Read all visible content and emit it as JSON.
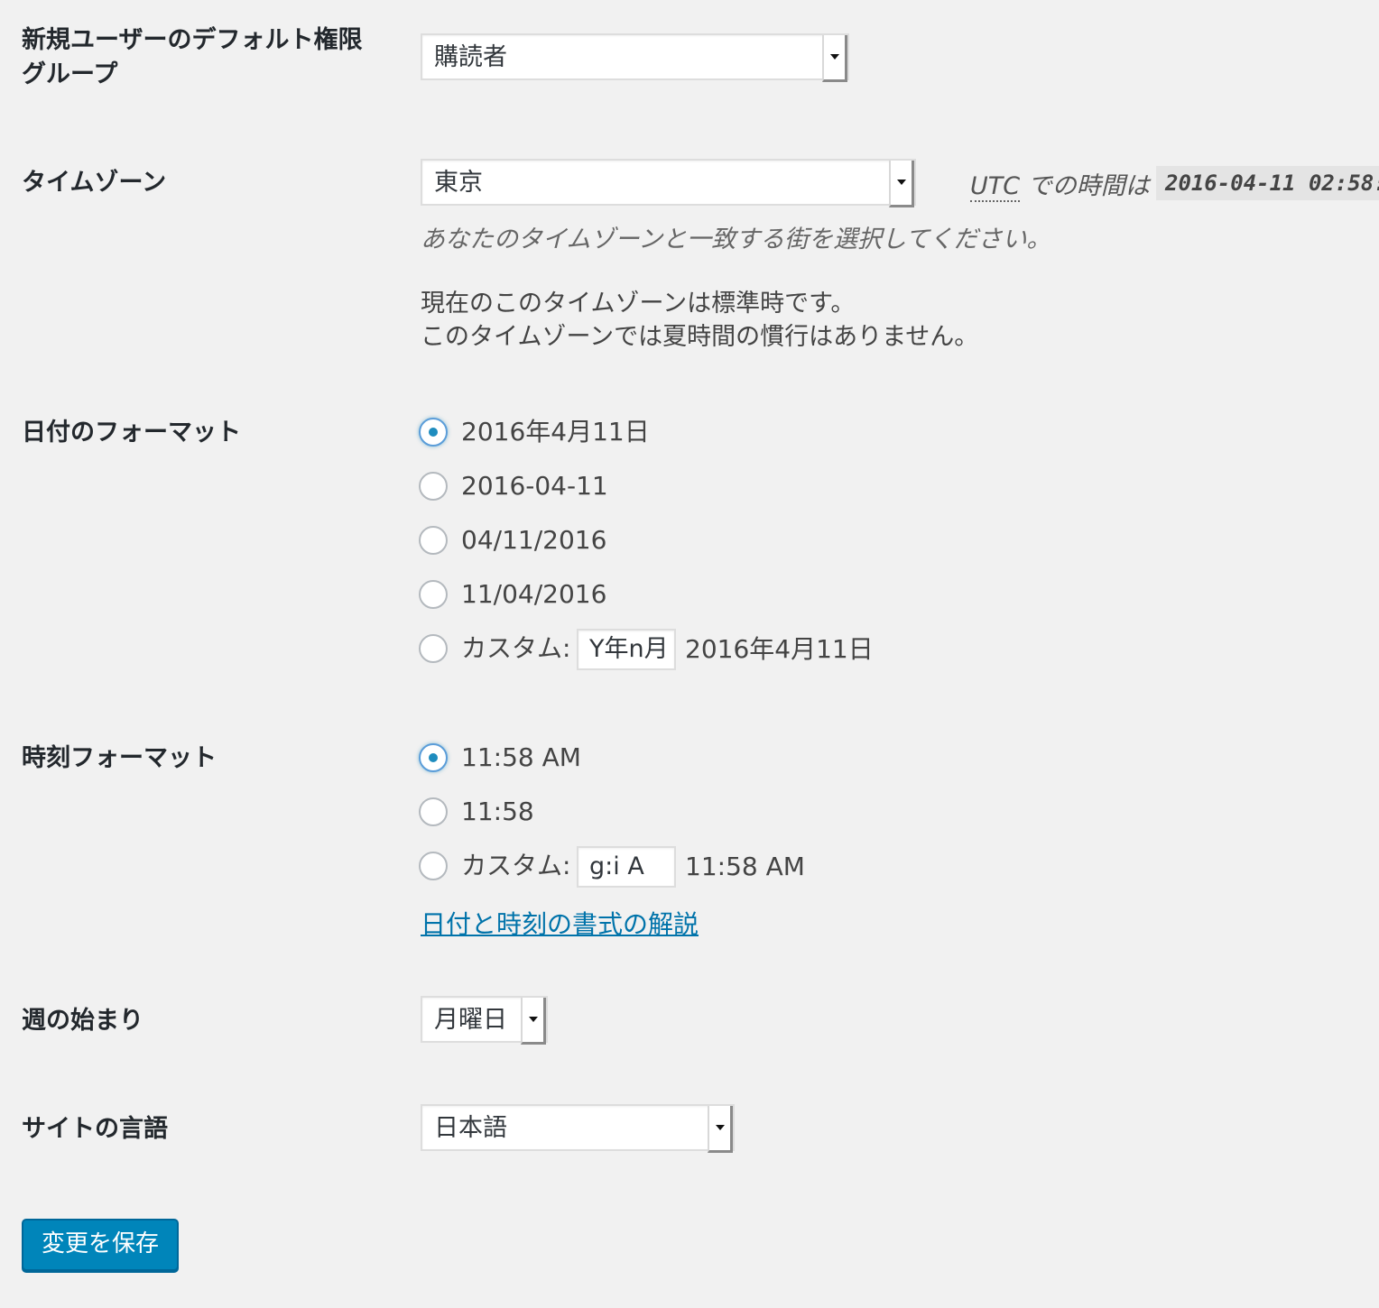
{
  "default_role": {
    "label": "新規ユーザーのデフォルト権限グループ",
    "label_line1": "新規ユーザーのデフォルト権限",
    "label_line2": "グループ",
    "value": "購読者"
  },
  "timezone": {
    "label": "タイムゾーン",
    "value": "東京",
    "utc_prefix": "UTC",
    "utc_suffix": " での時間は",
    "utc_time": "2016-04-11 02:58:",
    "description": "あなたのタイムゾーンと一致する街を選択してください。",
    "note_line1": "現在のこのタイムゾーンは標準時です。",
    "note_line2": "このタイムゾーンでは夏時間の慣行はありません。"
  },
  "date_format": {
    "label": "日付のフォーマット",
    "options": [
      {
        "label": "2016年4月11日",
        "checked": true
      },
      {
        "label": "2016-04-11",
        "checked": false
      },
      {
        "label": "04/11/2016",
        "checked": false
      },
      {
        "label": "11/04/2016",
        "checked": false
      }
    ],
    "custom_label": "カスタム:",
    "custom_value": "Y年n月",
    "custom_preview": "2016年4月11日"
  },
  "time_format": {
    "label": "時刻フォーマット",
    "options": [
      {
        "label": "11:58 AM",
        "checked": true
      },
      {
        "label": "11:58",
        "checked": false
      }
    ],
    "custom_label": "カスタム:",
    "custom_value": "g:i A",
    "custom_preview": "11:58 AM",
    "doc_link": "日付と時刻の書式の解説"
  },
  "week_start": {
    "label": "週の始まり",
    "value": "月曜日"
  },
  "site_language": {
    "label": "サイトの言語",
    "value": "日本語"
  },
  "save_button": "変更を保存",
  "colors": {
    "background": "#f1f1f1",
    "link": "#0073aa",
    "primary_button": "#0085ba",
    "radio_checked": "#1e8cbe"
  }
}
